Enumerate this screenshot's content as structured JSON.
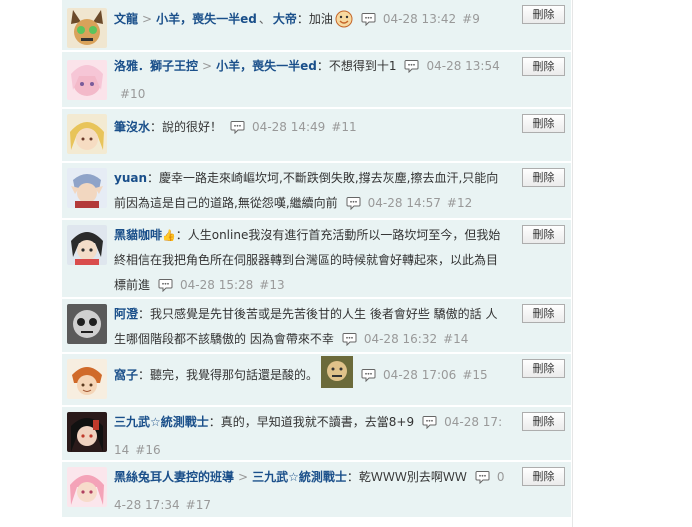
{
  "comments": [
    {
      "user": "文龍",
      "reply_target": "小羊，喪失一半ed",
      "mention": "大帝",
      "mention_sep": "、",
      "colon": "：",
      "text": "加油",
      "time": "04-28 13:42",
      "floor": "#9",
      "delete_label": "刪除"
    },
    {
      "user": "洛雅．獅子王控",
      "reply_target": "小羊，喪失一半ed",
      "colon": "：",
      "text": "不想得到十1",
      "time": "04-28 13:54",
      "floor": "#10",
      "delete_label": "刪除"
    },
    {
      "user": "筆沒水",
      "colon": "：",
      "text": "說的很好！",
      "time": "04-28 14:49",
      "floor": "#11",
      "delete_label": "刪除"
    },
    {
      "user": "yuan",
      "colon": "：",
      "text": "慶幸一路走來崎嶇坎坷,不斷跌倒失敗,撐去灰塵,擦去血汗,只能向前因為這是自己的道路,無從怨嘆,繼續向前",
      "time": "04-28 14:57",
      "floor": "#12",
      "delete_label": "刪除"
    },
    {
      "user": "黑貓咖啡",
      "colon": "：",
      "text": "人生online我沒有進行首充活動所以一路坎坷至今，但我始終相信在我把角色所在伺服器轉到台灣區的時候就會好轉起來，以此為目標前進",
      "time": "04-28 15:28",
      "floor": "#13",
      "delete_label": "刪除"
    },
    {
      "user": "阿澄",
      "colon": "：",
      "text": "我只感覺是先甘後苦或是先苦後甘的人生 後者會好些 驕傲的話 人生哪個階段都不該驕傲的 因為會帶來不幸",
      "time": "04-28 16:32",
      "floor": "#14",
      "delete_label": "刪除"
    },
    {
      "user": "窩子",
      "colon": "：",
      "text": "聽完，我覺得那句話還是酸的。",
      "time": "04-28 17:06",
      "floor": "#15",
      "delete_label": "刪除"
    },
    {
      "user": "三九武☆統測戰士",
      "colon": "：",
      "text": "真的，早知道我就不讀書，去當8+9",
      "time": "04-28 17:14",
      "floor": "#16",
      "delete_label": "刪除"
    },
    {
      "user": "黑絲兔耳人妻控的班導",
      "reply_target": "三九武☆統測戰士",
      "colon": "：",
      "text": "乾ＷＷＷ別去啊ＷＷ",
      "time": "04-28 17:34",
      "floor": "#17",
      "delete_label": "刪除"
    }
  ],
  "arrow_symbol": ">",
  "colors": {
    "row_bg": "#e9f3f3",
    "username": "#1a4f8a",
    "meta": "#999999"
  },
  "icons": [
    "reply-bubble-icon",
    "smiley-icon",
    "thumbs-up-icon",
    "sticker-image"
  ]
}
